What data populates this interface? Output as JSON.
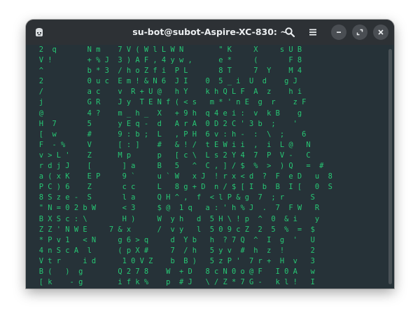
{
  "window": {
    "title": "su-bot@subot-Aspire-XC-830: ~",
    "new_tab_icon": "terminal-tab-icon",
    "search_icon": "search-icon",
    "menu_icon": "hamburger-menu-icon",
    "minimize_icon": "minimize-icon",
    "maximize_icon": "maximize-icon",
    "close_icon": "close-icon"
  },
  "terminal": {
    "lines": [
      "   2  q       N m    7 V ( W l L W N        \" K     X     s U B",
      "   V !        + % J  3 ) A F , 4 y w ,      e *     (       F 8",
      "   ^          b * 3  / h o Z f i  P L       8 T     7  Y    M 4",
      "   2          0 u c  E m ! & N 6  J I    0  5 _ i  U  d    g J",
      "   /          a c    v  R + U @   h Y    k h Q L F  A  z    h i",
      "   j          G R    J y  T E N f ( < s   m * ' n E  g  r    z F",
      "   @          4 ?    m _ h _  X   + 9 h  q 4 e i :  v  k B    g",
      "   H  7       5      y E q -  d   A r A  0 D 2 C ' 3 b  ;    '",
      "   [  w       #      9 : b ;  L   , P H  6 v : h -  :  \\  ;    6",
      "   F  - %     V      [ : ]    #   & ! /  t E W i i  ,  i  L @   N",
      "   v > L '    Z      M p      p   [ c \\  L s 2 Y 4  7  P  V -   C",
      "   r d j J    [       ] a     B   5   ^  C , ] / $  %  >  ) Q   =  #",
      "   a ( x K    E P     9 `     u ` W   x J  ! r x < d  ?  F  e D   u  8",
      "   P C ) 6    Z       c c     L   8 g + D  n / $ [ I  b  B  I [   0  S",
      "   8 S z e -  S       l a     Q H ^ ,  f  < l P & g  7  ; r      S",
      "   \" N = 0 2 b W      < 3     $ @  1 q   a : ' h % J  .  7  F W   R",
      "   B X S c : \\        H )     W  y h   d  5 H \\ ! p  ^  0  & i    y",
      "   Z Z ' N W E     7 & x      /  v y   l  5 0 9 c Z  2  5  %  =  $",
      "   * P v 1   < N     g 6 > q     d  Y b   h  ? 7 Q  ^  I  g  '   U",
      "   4 n S c A  l      ( p X #     7  / h   5 y v  #  h  z  !      2",
      "   V t r     i d      1 0 V Z    b  B )   5 z P '  7 r +  H  v   3",
      "   B (   )  g        Q 2 7 8    W  + D   8 c N 0 o @ F   I 0 A   w",
      "   [ k    - g        i f k %    p  # J   \\ / Z * 7 G -   k l !   I",
      "   w      9 i        J p !  m   :  & D   : Y j C G ( %  5  A 6 o   p"
    ]
  },
  "colors": {
    "terminal_bg": "#263238",
    "titlebar_bg": "#2d3135",
    "matrix_green": "#27c774",
    "highlight_text": "#ffffff",
    "title_text": "#eceff1"
  }
}
